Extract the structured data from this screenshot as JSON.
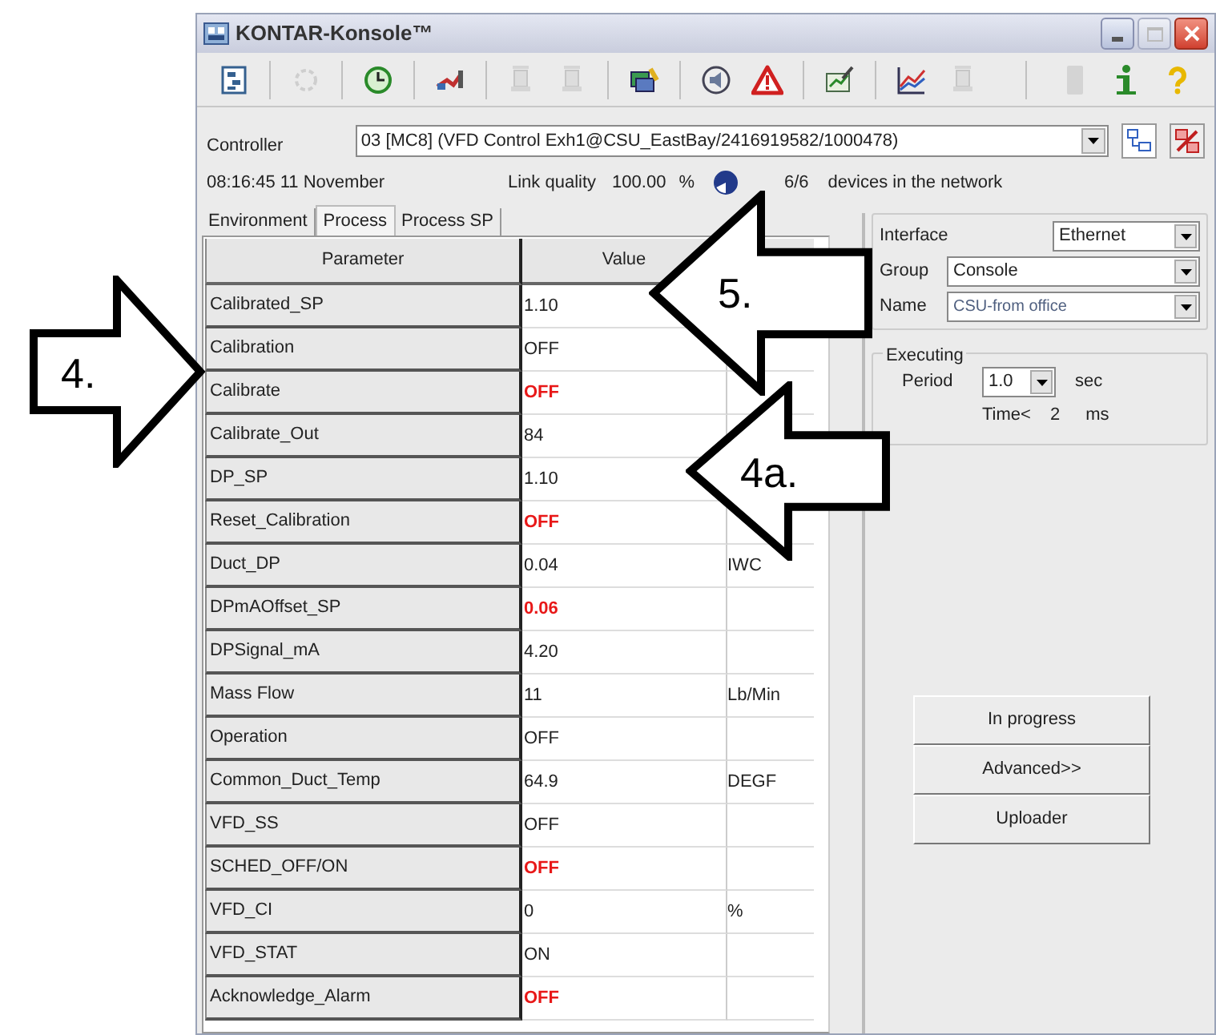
{
  "window": {
    "title": "KONTAR-Konsole™"
  },
  "toolbar": [
    {
      "kind": "tree",
      "disabled": false
    },
    {
      "kind": "cycle",
      "disabled": true
    },
    {
      "kind": "clock",
      "disabled": false
    },
    {
      "kind": "plug",
      "disabled": false
    },
    {
      "kind": "device",
      "disabled": true
    },
    {
      "kind": "device",
      "disabled": true
    },
    {
      "kind": "wrench",
      "disabled": false
    },
    {
      "kind": "speaker",
      "disabled": false
    },
    {
      "kind": "warning",
      "disabled": false
    },
    {
      "kind": "edit",
      "disabled": false
    },
    {
      "kind": "chart",
      "disabled": false
    },
    {
      "kind": "device",
      "disabled": true
    },
    {
      "kind": "bar",
      "disabled": true
    },
    {
      "kind": "info",
      "disabled": false
    },
    {
      "kind": "help",
      "disabled": false
    }
  ],
  "controller": {
    "label": "Controller",
    "value": "03 [MC8] (VFD Control Exh1@CSU_EastBay/2416919582/1000478)"
  },
  "status": {
    "time": "08:16:45 11 November",
    "link_label": "Link quality",
    "link_value": "100.00",
    "link_unit": "%",
    "devices_count": "6/6",
    "devices_label": "devices in the network"
  },
  "tabs": [
    {
      "label": "Environment",
      "selected": false
    },
    {
      "label": "Process",
      "selected": true
    },
    {
      "label": "Process SP",
      "selected": false
    }
  ],
  "table": {
    "columns": [
      "Parameter",
      "Value"
    ],
    "rows": [
      {
        "parameter": "Calibrated_SP",
        "value": "1.10",
        "highlighted": false
      },
      {
        "parameter": "Calibration",
        "value": "OFF",
        "highlighted": false
      },
      {
        "parameter": "Calibrate",
        "value": "OFF",
        "highlighted": true
      },
      {
        "parameter": "Calibrate_Out",
        "value": "84",
        "highlighted": false
      },
      {
        "parameter": "DP_SP",
        "value": "1.10",
        "highlighted": false
      },
      {
        "parameter": "Reset_Calibration",
        "value": "OFF",
        "highlighted": true
      },
      {
        "parameter": "Duct_DP",
        "value": "0.04",
        "unit": "IWC",
        "highlighted": false
      },
      {
        "parameter": "DPmAOffset_SP",
        "value": "0.06",
        "highlighted": true
      },
      {
        "parameter": "DPSignal_mA",
        "value": "4.20",
        "highlighted": false
      },
      {
        "parameter": "Mass Flow",
        "value": "11",
        "unit": "Lb/Min",
        "highlighted": false
      },
      {
        "parameter": "Operation",
        "value": "OFF",
        "highlighted": false
      },
      {
        "parameter": "Common_Duct_Temp",
        "value": "64.9",
        "unit": "DEGF",
        "highlighted": false
      },
      {
        "parameter": "VFD_SS",
        "value": "OFF",
        "highlighted": false
      },
      {
        "parameter": "SCHED_OFF/ON",
        "value": "OFF",
        "highlighted": true
      },
      {
        "parameter": "VFD_CI",
        "value": "0",
        "unit": "%",
        "highlighted": false
      },
      {
        "parameter": "VFD_STAT",
        "value": "ON",
        "highlighted": false
      },
      {
        "parameter": "Acknowledge_Alarm",
        "value": "OFF",
        "highlighted": true
      }
    ]
  },
  "connection": {
    "interface_label": "Interface",
    "interface": "Ethernet",
    "group_label": "Group",
    "group": "Console",
    "name_label": "Name",
    "name": "CSU-from office"
  },
  "executing": {
    "title": "Executing",
    "period_label": "Period",
    "period": "1.0",
    "period_unit": "sec",
    "time_label": "Time<",
    "time": "2",
    "time_unit": "ms"
  },
  "buttons": [
    "In progress",
    "Advanced>>",
    "Uploader"
  ],
  "annotations": [
    {
      "label": "4."
    },
    {
      "label": "5."
    },
    {
      "label": "4a."
    }
  ]
}
